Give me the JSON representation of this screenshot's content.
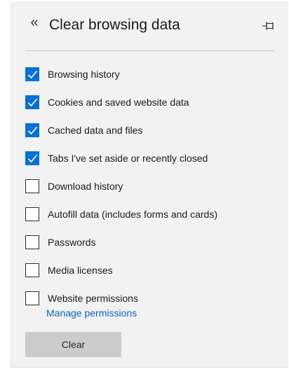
{
  "header": {
    "back_glyph": "«",
    "title": "Clear browsing data",
    "pin_icon": "pin-icon"
  },
  "options": [
    {
      "label": "Browsing history",
      "checked": true
    },
    {
      "label": "Cookies and saved website data",
      "checked": true
    },
    {
      "label": "Cached data and files",
      "checked": true
    },
    {
      "label": "Tabs I've set aside or recently closed",
      "checked": true
    },
    {
      "label": "Download history",
      "checked": false
    },
    {
      "label": "Autofill data (includes forms and cards)",
      "checked": false
    },
    {
      "label": "Passwords",
      "checked": false
    },
    {
      "label": "Media licenses",
      "checked": false
    },
    {
      "label": "Website permissions",
      "checked": false
    }
  ],
  "manage_link": "Manage permissions",
  "clear_button": "Clear",
  "colors": {
    "accent": "#0a70d6",
    "link": "#0b63c1",
    "panel_bg": "#f2f2f2",
    "button_bg": "#cccccc"
  }
}
